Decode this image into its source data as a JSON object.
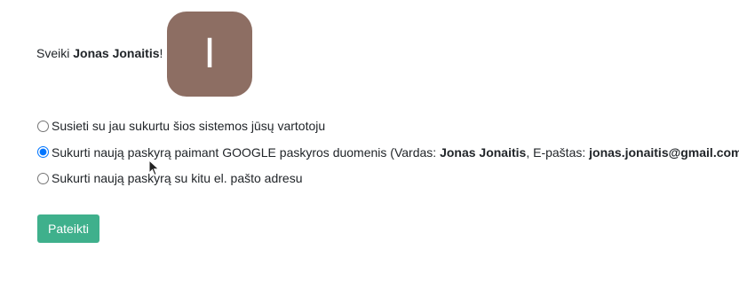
{
  "greeting": {
    "prefix": "Sveiki ",
    "name": "Jonas Jonaitis",
    "suffix": "!"
  },
  "avatar": {
    "initial": "I",
    "bg_color": "#8d6e63"
  },
  "options": [
    {
      "label": "Susieti su jau sukurtu šios sistemos jūsų vartotoju",
      "checked": false
    },
    {
      "label_prefix": "Sukurti naują paskyrą paimant GOOGLE paskyros duomenis (Vardas: ",
      "name": "Jonas Jonaitis",
      "email_prefix": ", E-paštas: ",
      "email": "jonas.jonaitis@gmail.com",
      "label_suffix": ")",
      "checked": true
    },
    {
      "label": "Sukurti naują paskyrą su kitu el. pašto adresu",
      "checked": false
    }
  ],
  "submit": {
    "label": "Pateikti",
    "color": "#3fb08c"
  }
}
